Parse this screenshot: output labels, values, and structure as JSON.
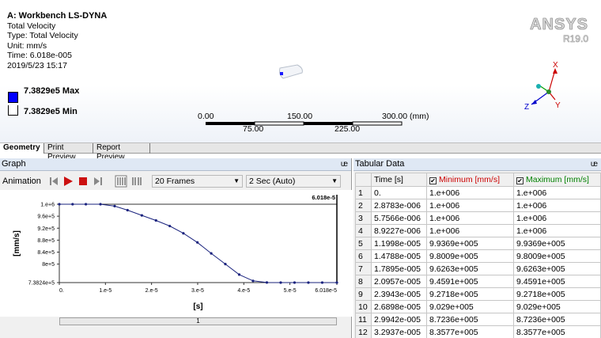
{
  "viewport": {
    "result_info": {
      "title": "A: Workbench LS-DYNA",
      "lines": [
        "Total Velocity",
        "Type: Total Velocity",
        "Unit: mm/s",
        "Time: 6.018e-005",
        "2019/5/23 15:17"
      ]
    },
    "legend": {
      "max_label": "7.3829e5 Max",
      "min_label": "7.3829e5 Min",
      "max_color": "#0000ff"
    },
    "brand": {
      "name": "ANSYS",
      "version": "R19.0"
    },
    "scale": {
      "top_labels": [
        "0.00",
        "150.00",
        "300.00 (mm)"
      ],
      "bottom_labels": [
        "75.00",
        "225.00"
      ]
    },
    "triad": {
      "x": "X",
      "y": "Y",
      "z": "Z"
    }
  },
  "tabs": [
    "Geometry",
    "Print Preview",
    "Report Preview"
  ],
  "graph": {
    "panel_title": "Graph",
    "animation_label": "Animation",
    "frames_value": "20 Frames",
    "duration_value": "2 Sec (Auto)",
    "scrollbar_label": "1",
    "chart_data": {
      "type": "line",
      "title": "",
      "xlabel": "[s]",
      "ylabel": "[mm/s]",
      "marker_label": "6.018e-5",
      "x_tick_labels": [
        "0.",
        "1.e-5",
        "2.e-5",
        "3.e-5",
        "4.e-5",
        "5.e-5",
        "6.018e-5"
      ],
      "x_ticks": [
        0,
        1e-05,
        2e-05,
        3e-05,
        4e-05,
        5e-05,
        6.018e-05
      ],
      "y_tick_labels": [
        "1.e+6",
        "9.6e+5",
        "9.2e+5",
        "8.8e+5",
        "8.4e+5",
        "8e+5",
        "7.3824e+5"
      ],
      "y_ticks": [
        1000000,
        960000,
        920000,
        880000,
        840000,
        800000,
        738240
      ],
      "xlim": [
        0,
        6.018e-05
      ],
      "ylim": [
        738240,
        1000000
      ],
      "series": [
        {
          "color": "#1a237e",
          "x": [
            0,
            2.8783e-06,
            5.7566e-06,
            8.9227e-06,
            1.1998e-05,
            1.4788e-05,
            1.7895e-05,
            2.0957e-05,
            2.3943e-05,
            2.6898e-05,
            2.9942e-05,
            3.2937e-05,
            3.6e-05,
            3.9e-05,
            4.2e-05,
            4.5e-05,
            4.8e-05,
            5.1e-05,
            5.4e-05,
            5.7e-05,
            6.018e-05
          ],
          "y": [
            1000000,
            1000000,
            1000000,
            1000000,
            993690,
            980090,
            962630,
            945910,
            927180,
            902900,
            872360,
            835770,
            800000,
            765000,
            744000,
            738500,
            738300,
            738290,
            738290,
            738290,
            738290
          ]
        }
      ]
    }
  },
  "table": {
    "panel_title": "Tabular Data",
    "headers": [
      "",
      "Time [s]",
      "Minimum [mm/s]",
      "Maximum [mm/s]"
    ],
    "header_colors": [
      "#000000",
      "#000000",
      "#cc0000",
      "#008000"
    ],
    "rows": [
      [
        "1",
        "0.",
        "1.e+006",
        "1.e+006"
      ],
      [
        "2",
        "2.8783e-006",
        "1.e+006",
        "1.e+006"
      ],
      [
        "3",
        "5.7566e-006",
        "1.e+006",
        "1.e+006"
      ],
      [
        "4",
        "8.9227e-006",
        "1.e+006",
        "1.e+006"
      ],
      [
        "5",
        "1.1998e-005",
        "9.9369e+005",
        "9.9369e+005"
      ],
      [
        "6",
        "1.4788e-005",
        "9.8009e+005",
        "9.8009e+005"
      ],
      [
        "7",
        "1.7895e-005",
        "9.6263e+005",
        "9.6263e+005"
      ],
      [
        "8",
        "2.0957e-005",
        "9.4591e+005",
        "9.4591e+005"
      ],
      [
        "9",
        "2.3943e-005",
        "9.2718e+005",
        "9.2718e+005"
      ],
      [
        "10",
        "2.6898e-005",
        "9.029e+005",
        "9.029e+005"
      ],
      [
        "11",
        "2.9942e-005",
        "8.7236e+005",
        "8.7236e+005"
      ],
      [
        "12",
        "3.2937e-005",
        "8.3577e+005",
        "8.3577e+005"
      ]
    ]
  }
}
